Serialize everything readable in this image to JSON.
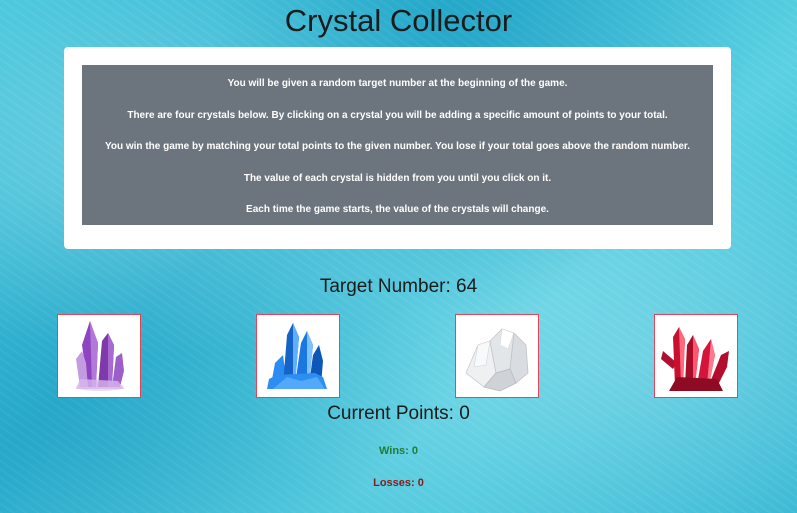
{
  "title": "Crystal Collector",
  "instructions": [
    "You will be given a random target number at the beginning of the game.",
    "There are four crystals below. By clicking on a crystal you will be adding a specific amount of points to your total.",
    "You win the game by matching your total points to the given number. You lose if your total goes above the random number.",
    "The value of each crystal is hidden from you until you click on it.",
    "Each time the game starts, the value of the crystals will change."
  ],
  "target": {
    "label": "Target Number: ",
    "value": "64"
  },
  "crystals": [
    {
      "name": "purple-crystal-icon",
      "color": "#9b59c8"
    },
    {
      "name": "blue-crystal-icon",
      "color": "#1f7fe0"
    },
    {
      "name": "clear-crystal-icon",
      "color": "#d9dde2"
    },
    {
      "name": "red-crystal-icon",
      "color": "#c8102e"
    }
  ],
  "current_points": {
    "label": "Current Points: ",
    "value": "0"
  },
  "wins": {
    "label": "Wins: ",
    "value": "0"
  },
  "losses": {
    "label": "Losses: ",
    "value": "0"
  },
  "colors": {
    "instructions_bg": "#6c757d",
    "wins": "#1e7e34",
    "losses": "#8b1a1a",
    "crystal_border": "#e0455a"
  }
}
